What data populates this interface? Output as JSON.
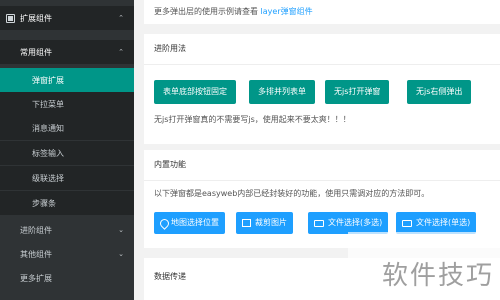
{
  "sidebar": {
    "top_section": "扩展组件",
    "group": "常用组件",
    "items": [
      {
        "label": "弹窗扩展",
        "active": true
      },
      {
        "label": "下拉菜单"
      },
      {
        "label": "消息通知"
      },
      {
        "label": "标签输入"
      },
      {
        "label": "级联选择"
      },
      {
        "label": "步骤条"
      }
    ],
    "collapsed": [
      {
        "label": "进阶组件"
      },
      {
        "label": "其他组件"
      },
      {
        "label": "更多扩展"
      }
    ]
  },
  "main": {
    "top_note": {
      "prefix": "更多弹出层的使用示例请查看 ",
      "link": "layer弹窗组件"
    },
    "advanced": {
      "title": "进阶用法",
      "buttons": [
        "表单底部按钮固定",
        "多排并列表单",
        "无js打开弹窗",
        "无js右侧弹出"
      ],
      "note": "无js打开弹窗真的不需要写js，使用起来不要太爽！！！"
    },
    "builtin": {
      "title": "内置功能",
      "desc": "以下弹窗都是easyweb内部已经封装好的功能，使用只需调对应的方法即可。",
      "buttons": [
        "地图选择位置",
        "裁剪图片",
        "文件选择(多选)",
        "文件选择(单选)"
      ]
    },
    "data_pass": {
      "title": "数据传递"
    }
  },
  "watermark": "软件技巧",
  "colors": {
    "sidebar_bg": "#2f3335",
    "active": "#009688",
    "blue": "#1e9fff"
  }
}
